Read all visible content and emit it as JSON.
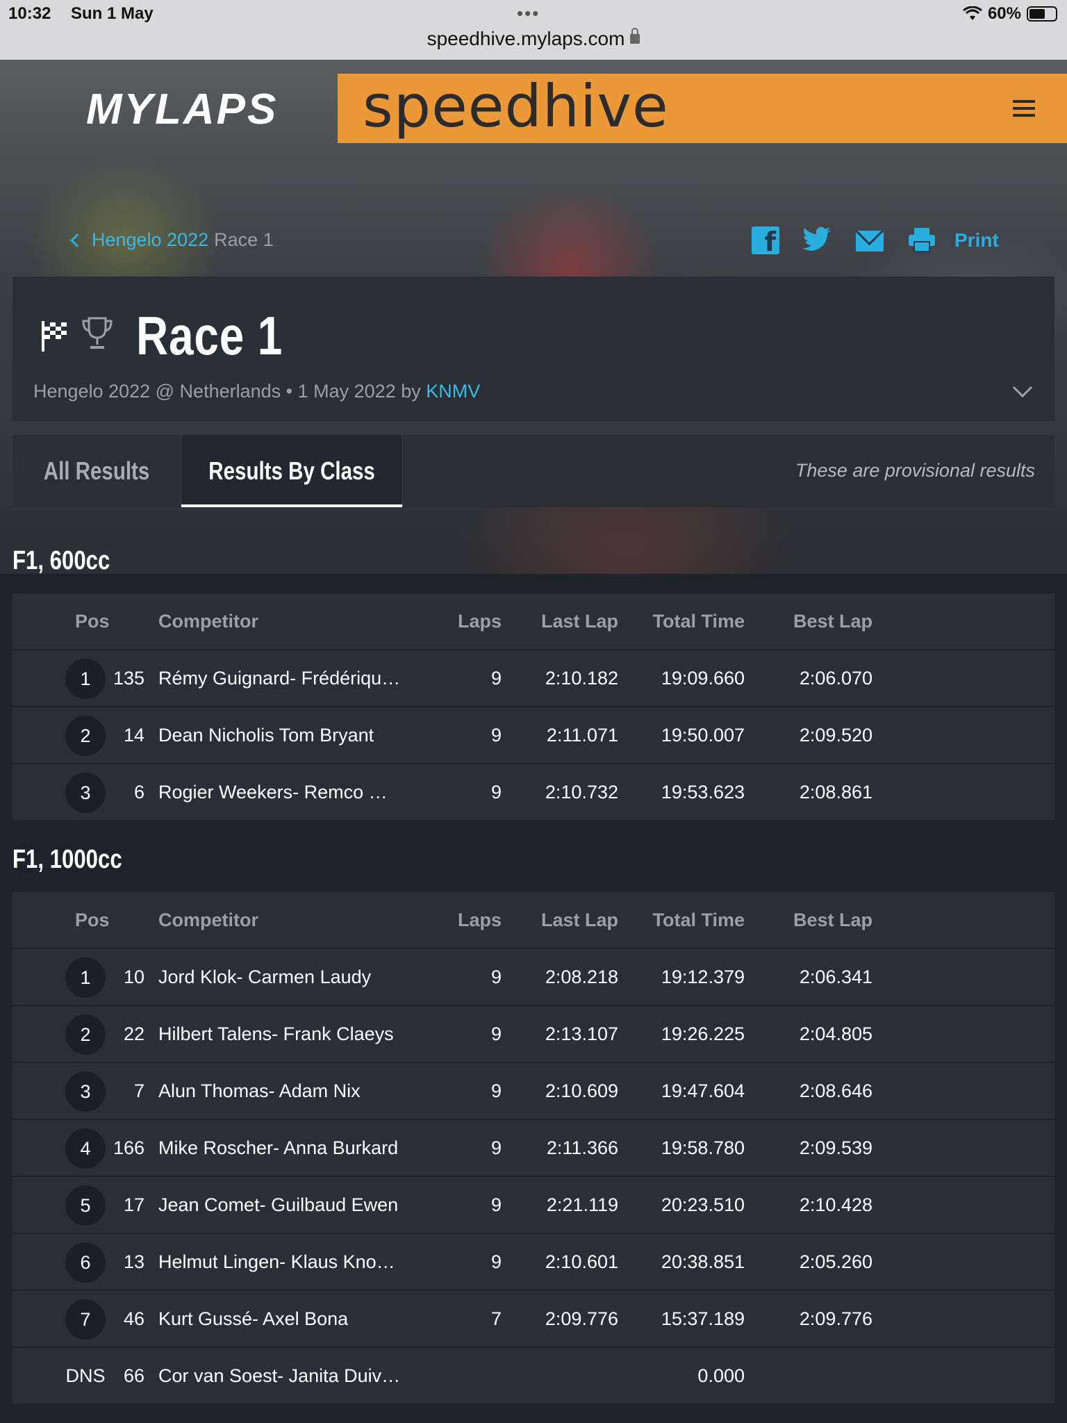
{
  "status_bar": {
    "time": "10:32",
    "date": "Sun 1 May",
    "battery": "60%",
    "battery_level": 0.6
  },
  "browser": {
    "url": "speedhive.mylaps.com"
  },
  "brand": {
    "mylaps": "MYLAPS",
    "speedhive": "speedhive",
    "accent": "#ea9838",
    "link_color": "#3db7e6"
  },
  "breadcrumb": {
    "parent": "Hengelo 2022",
    "current": "Race 1"
  },
  "share": {
    "print": "Print",
    "icons": [
      "facebook-icon",
      "twitter-icon",
      "mail-icon",
      "print-icon"
    ]
  },
  "race": {
    "title": "Race 1",
    "subtitle_event": "Hengelo 2022 @ Netherlands • 1 May 2022 by ",
    "organizer": "KNMV"
  },
  "tabs": {
    "all": "All Results",
    "by_class": "Results By Class",
    "note": "These are provisional results"
  },
  "columns": {
    "pos": "Pos",
    "competitor": "Competitor",
    "laps": "Laps",
    "last_lap": "Last Lap",
    "total_time": "Total Time",
    "best_lap": "Best Lap"
  },
  "classes": [
    {
      "name": "F1, 600cc",
      "rows": [
        {
          "pos": "1",
          "num": "135",
          "competitor": "Rémy Guignard- Frédériqu…",
          "laps": "9",
          "last_lap": "2:10.182",
          "total_time": "19:09.660",
          "best_lap": "2:06.070"
        },
        {
          "pos": "2",
          "num": "14",
          "competitor": "Dean Nicholis Tom Bryant",
          "laps": "9",
          "last_lap": "2:11.071",
          "total_time": "19:50.007",
          "best_lap": "2:09.520"
        },
        {
          "pos": "3",
          "num": "6",
          "competitor": "Rogier Weekers- Remco …",
          "laps": "9",
          "last_lap": "2:10.732",
          "total_time": "19:53.623",
          "best_lap": "2:08.861"
        }
      ]
    },
    {
      "name": "F1, 1000cc",
      "rows": [
        {
          "pos": "1",
          "num": "10",
          "competitor": "Jord Klok- Carmen Laudy",
          "laps": "9",
          "last_lap": "2:08.218",
          "total_time": "19:12.379",
          "best_lap": "2:06.341"
        },
        {
          "pos": "2",
          "num": "22",
          "competitor": "Hilbert Talens- Frank Claeys",
          "laps": "9",
          "last_lap": "2:13.107",
          "total_time": "19:26.225",
          "best_lap": "2:04.805"
        },
        {
          "pos": "3",
          "num": "7",
          "competitor": "Alun Thomas- Adam Nix",
          "laps": "9",
          "last_lap": "2:10.609",
          "total_time": "19:47.604",
          "best_lap": "2:08.646"
        },
        {
          "pos": "4",
          "num": "166",
          "competitor": "Mike Roscher- Anna Burkard",
          "laps": "9",
          "last_lap": "2:11.366",
          "total_time": "19:58.780",
          "best_lap": "2:09.539"
        },
        {
          "pos": "5",
          "num": "17",
          "competitor": "Jean Comet- Guilbaud Ewen",
          "laps": "9",
          "last_lap": "2:21.119",
          "total_time": "20:23.510",
          "best_lap": "2:10.428"
        },
        {
          "pos": "6",
          "num": "13",
          "competitor": "Helmut Lingen- Klaus Kno…",
          "laps": "9",
          "last_lap": "2:10.601",
          "total_time": "20:38.851",
          "best_lap": "2:05.260"
        },
        {
          "pos": "7",
          "num": "46",
          "competitor": "Kurt Gussé- Axel Bona",
          "laps": "7",
          "last_lap": "2:09.776",
          "total_time": "15:37.189",
          "best_lap": "2:09.776"
        },
        {
          "pos": "DNS",
          "num": "66",
          "competitor": "Cor van Soest- Janita Duiv…",
          "laps": "",
          "last_lap": "",
          "total_time": "0.000",
          "best_lap": ""
        }
      ]
    }
  ]
}
